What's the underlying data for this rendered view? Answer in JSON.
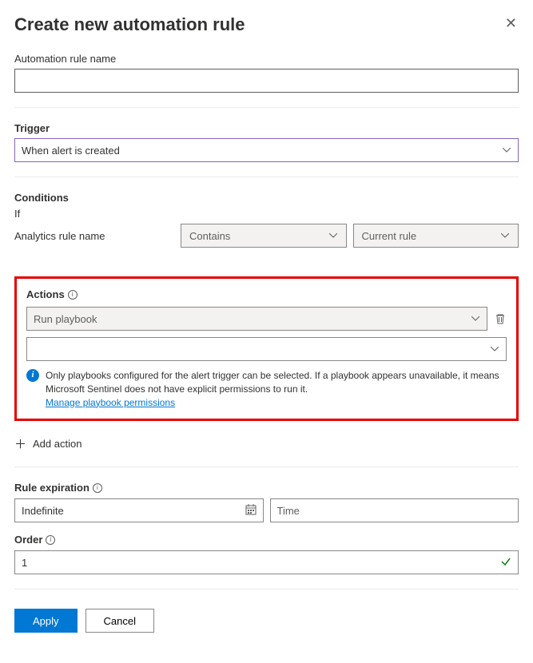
{
  "header": {
    "title": "Create new automation rule"
  },
  "name_section": {
    "label": "Automation rule name",
    "value": ""
  },
  "trigger": {
    "label": "Trigger",
    "selected": "When alert is created"
  },
  "conditions": {
    "label": "Conditions",
    "if_label": "If",
    "analytics_label": "Analytics rule name",
    "operator": "Contains",
    "value": "Current rule"
  },
  "actions": {
    "label": "Actions",
    "playbook_label": "Run playbook",
    "selected_playbook": "",
    "info_text": "Only playbooks configured for the alert trigger can be selected. If a playbook appears unavailable, it means Microsoft Sentinel does not have explicit permissions to run it.",
    "permissions_link": "Manage playbook permissions"
  },
  "add_action": {
    "label": "Add action"
  },
  "expiration": {
    "label": "Rule expiration",
    "date_value": "Indefinite",
    "time_placeholder": "Time"
  },
  "order": {
    "label": "Order",
    "value": "1"
  },
  "footer": {
    "apply": "Apply",
    "cancel": "Cancel"
  }
}
